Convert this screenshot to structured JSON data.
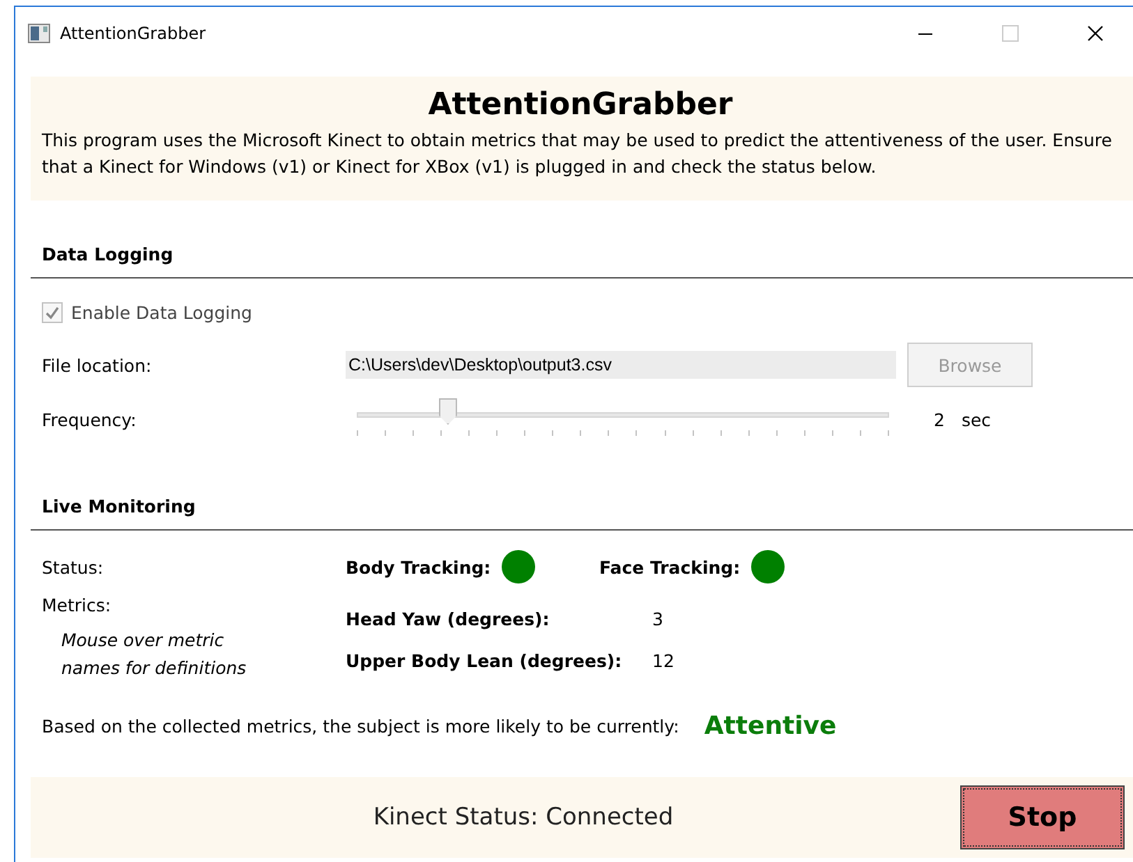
{
  "window": {
    "title": "AttentionGrabber"
  },
  "header": {
    "title": "AttentionGrabber",
    "description": "This program uses the Microsoft Kinect to obtain metrics that may be used to predict the attentiveness of the user. Ensure that a Kinect for Windows (v1) or Kinect for XBox (v1) is plugged in and check the status below."
  },
  "data_logging": {
    "heading": "Data Logging",
    "enable": {
      "label": "Enable Data Logging",
      "checked": true,
      "disabled": true
    },
    "file_location": {
      "label": "File location:",
      "value": "C:\\Users\\dev\\Desktop\\output3.csv"
    },
    "browse": {
      "label": "Browse",
      "disabled": true
    },
    "frequency": {
      "label": "Frequency:",
      "level": 0.17,
      "value": "2",
      "unit": "sec"
    }
  },
  "live_monitoring": {
    "heading": "Live Monitoring",
    "status_label": "Status:",
    "trackers": [
      {
        "label": "Body Tracking:",
        "color": "#008000"
      },
      {
        "label": "Face Tracking:",
        "color": "#008000"
      }
    ],
    "metrics_label": "Metrics:",
    "metrics_hint": "Mouse over metric names for definitions",
    "metrics": [
      {
        "name": "Head Yaw (degrees):",
        "value": "3"
      },
      {
        "name": "Upper Body Lean (degrees):",
        "value": "12"
      }
    ],
    "prediction_text": "Based on the collected metrics, the subject is more likely to be currently:",
    "prediction": "Attentive"
  },
  "footer": {
    "status": "Kinect Status: Connected",
    "button": "Stop"
  }
}
